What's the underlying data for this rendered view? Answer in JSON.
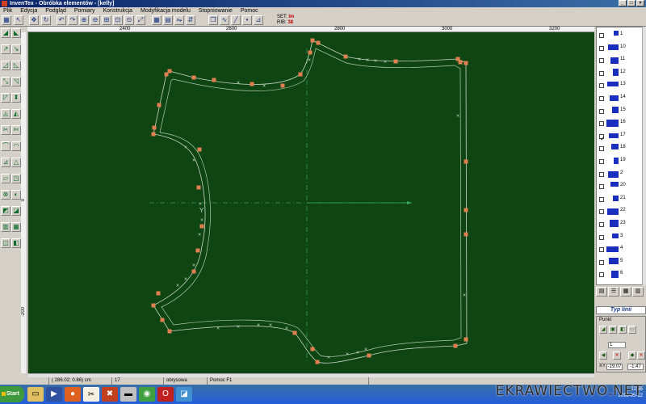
{
  "window": {
    "title": "InvenTex - Obróbka elementów - [kelly]"
  },
  "menu": [
    "Plik",
    "Edycja",
    "Podgląd",
    "Pomiary",
    "Konstrukcja",
    "Modyfikacja modelu",
    "Stopniowanie",
    "Pomoc"
  ],
  "toolbar": {
    "set_label": "SET:",
    "set_value": "lm",
    "rib_label": "RIB:",
    "rib_value": "38",
    "icons": [
      "select-icon",
      "pointer-icon",
      "move-icon",
      "rotate-icon",
      "undo-icon",
      "redo-icon",
      "zoom-in-icon",
      "zoom-out-icon",
      "zoom-window-icon",
      "zoom-all-icon",
      "zoom-piece-icon",
      "fit-icon",
      "grid-icon",
      "layers-icon",
      "flip-h-icon",
      "flip-v-icon",
      "copy-icon",
      "curve-icon",
      "line-icon",
      "point-icon",
      "measure-icon"
    ]
  },
  "ruler": {
    "top_ticks": [
      "2400",
      "2600",
      "2800",
      "3000",
      "3200"
    ],
    "left_ticks": [
      "0",
      "-200"
    ]
  },
  "pieces": [
    {
      "num": "1",
      "checked": false
    },
    {
      "num": "10",
      "checked": false
    },
    {
      "num": "11",
      "checked": false
    },
    {
      "num": "12",
      "checked": false
    },
    {
      "num": "13",
      "checked": false
    },
    {
      "num": "14",
      "checked": false
    },
    {
      "num": "15",
      "checked": false
    },
    {
      "num": "16",
      "checked": false
    },
    {
      "num": "17",
      "checked": true
    },
    {
      "num": "18",
      "checked": false
    },
    {
      "num": "19",
      "checked": false
    },
    {
      "num": "2",
      "checked": false
    },
    {
      "num": "20",
      "checked": false
    },
    {
      "num": "21",
      "checked": false
    },
    {
      "num": "22",
      "checked": false
    },
    {
      "num": "23",
      "checked": false
    },
    {
      "num": "3",
      "checked": false
    },
    {
      "num": "4",
      "checked": false
    },
    {
      "num": "5",
      "checked": false
    },
    {
      "num": "6",
      "checked": false
    }
  ],
  "right_panel": {
    "line_type_label": "Typ linii",
    "point_label": "Punkt",
    "point_field": "1",
    "xy_label": "XY",
    "x_value": "-19.07",
    "y_value": "-1.47"
  },
  "status": {
    "coords": "( 286.02; 0.86) cm",
    "piece": "17",
    "mode": "obrysowa",
    "help": "Pomoc F1"
  },
  "taskbar": {
    "start": "Start",
    "apps": [
      "folder-icon",
      "media-icon",
      "firefox-icon",
      "inventex-icon",
      "tools-icon",
      "keyboard-icon",
      "chrome-icon",
      "opera-icon",
      "paint-icon"
    ],
    "time": "11:55",
    "date": "2016-05-12"
  },
  "watermark": "EKRAWIECTWO.NET",
  "colors": {
    "canvas_bg": "#0e4512",
    "outline": "#c8d8c8",
    "point": "#e08050",
    "axis": "#3a9a5a",
    "title_bar": "#0a246a"
  }
}
